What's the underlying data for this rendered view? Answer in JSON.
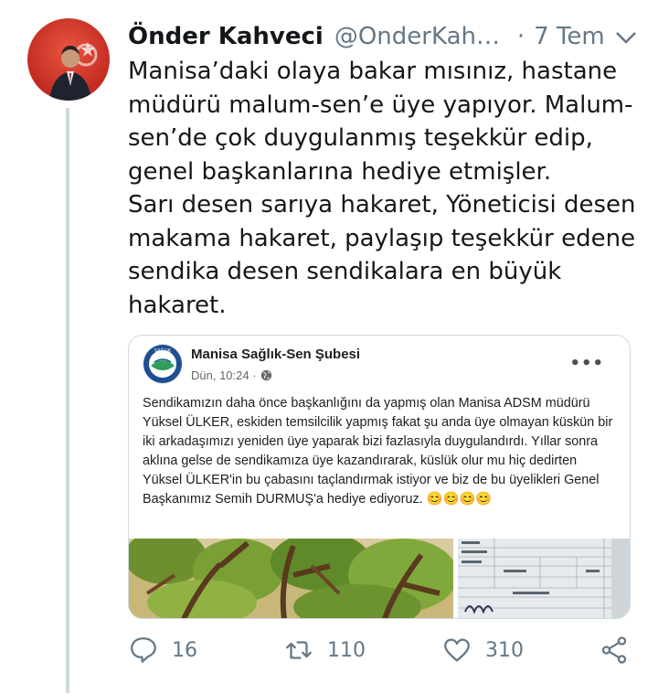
{
  "tweet": {
    "author_name": "Önder Kahveci",
    "author_handle": "@OnderKahveci",
    "separator": "·",
    "timestamp": "7 Tem",
    "text": "Manisa’daki olaya bakar mısınız, hastane\nmüdürü malum-sen’e üye yapıyor. Malum-\nsen’de çok duygulanmış teşekkür edip,\ngenel başkanlarına hediye etmişler.\nSarı desen sarıya hakaret, Yöneticisi desen\nmakama hakaret, paylaşıp teşekkür edene\nsendika desen sendikalara en büyük\nhakaret."
  },
  "embedded_post": {
    "page_name": "Manisa Sağlık-Sen Şubesi",
    "post_time": "Dün, 10:24 ·",
    "more_label": "•••",
    "body": "Sendikamızın daha önce başkanlığını da yapmış olan Manisa ADSM müdürü Yüksel ÜLKER, eskiden temsilcilik yapmış fakat şu anda üye olmayan küskün bir iki arkadaşımızı yeniden üye yaparak bizi fazlasıyla duygulandırdı. Yıllar sonra aklına gelse de sendikamıza üye kazandırarak, küslük olur mu hiç dedirten Yüksel ÜLKER'in bu çabasını taçlandırmak istiyor ve biz de bu üyelikleri Genel Başkanımız Semih DURMUŞ'a hediye ediyoruz. 😊😊😊😊",
    "logo_text": "SAĞLIK"
  },
  "actions": {
    "reply_count": "16",
    "retweet_count": "110",
    "like_count": "310"
  },
  "colors": {
    "text": "#14171a",
    "secondary": "#657786",
    "border": "#cfd9de"
  }
}
